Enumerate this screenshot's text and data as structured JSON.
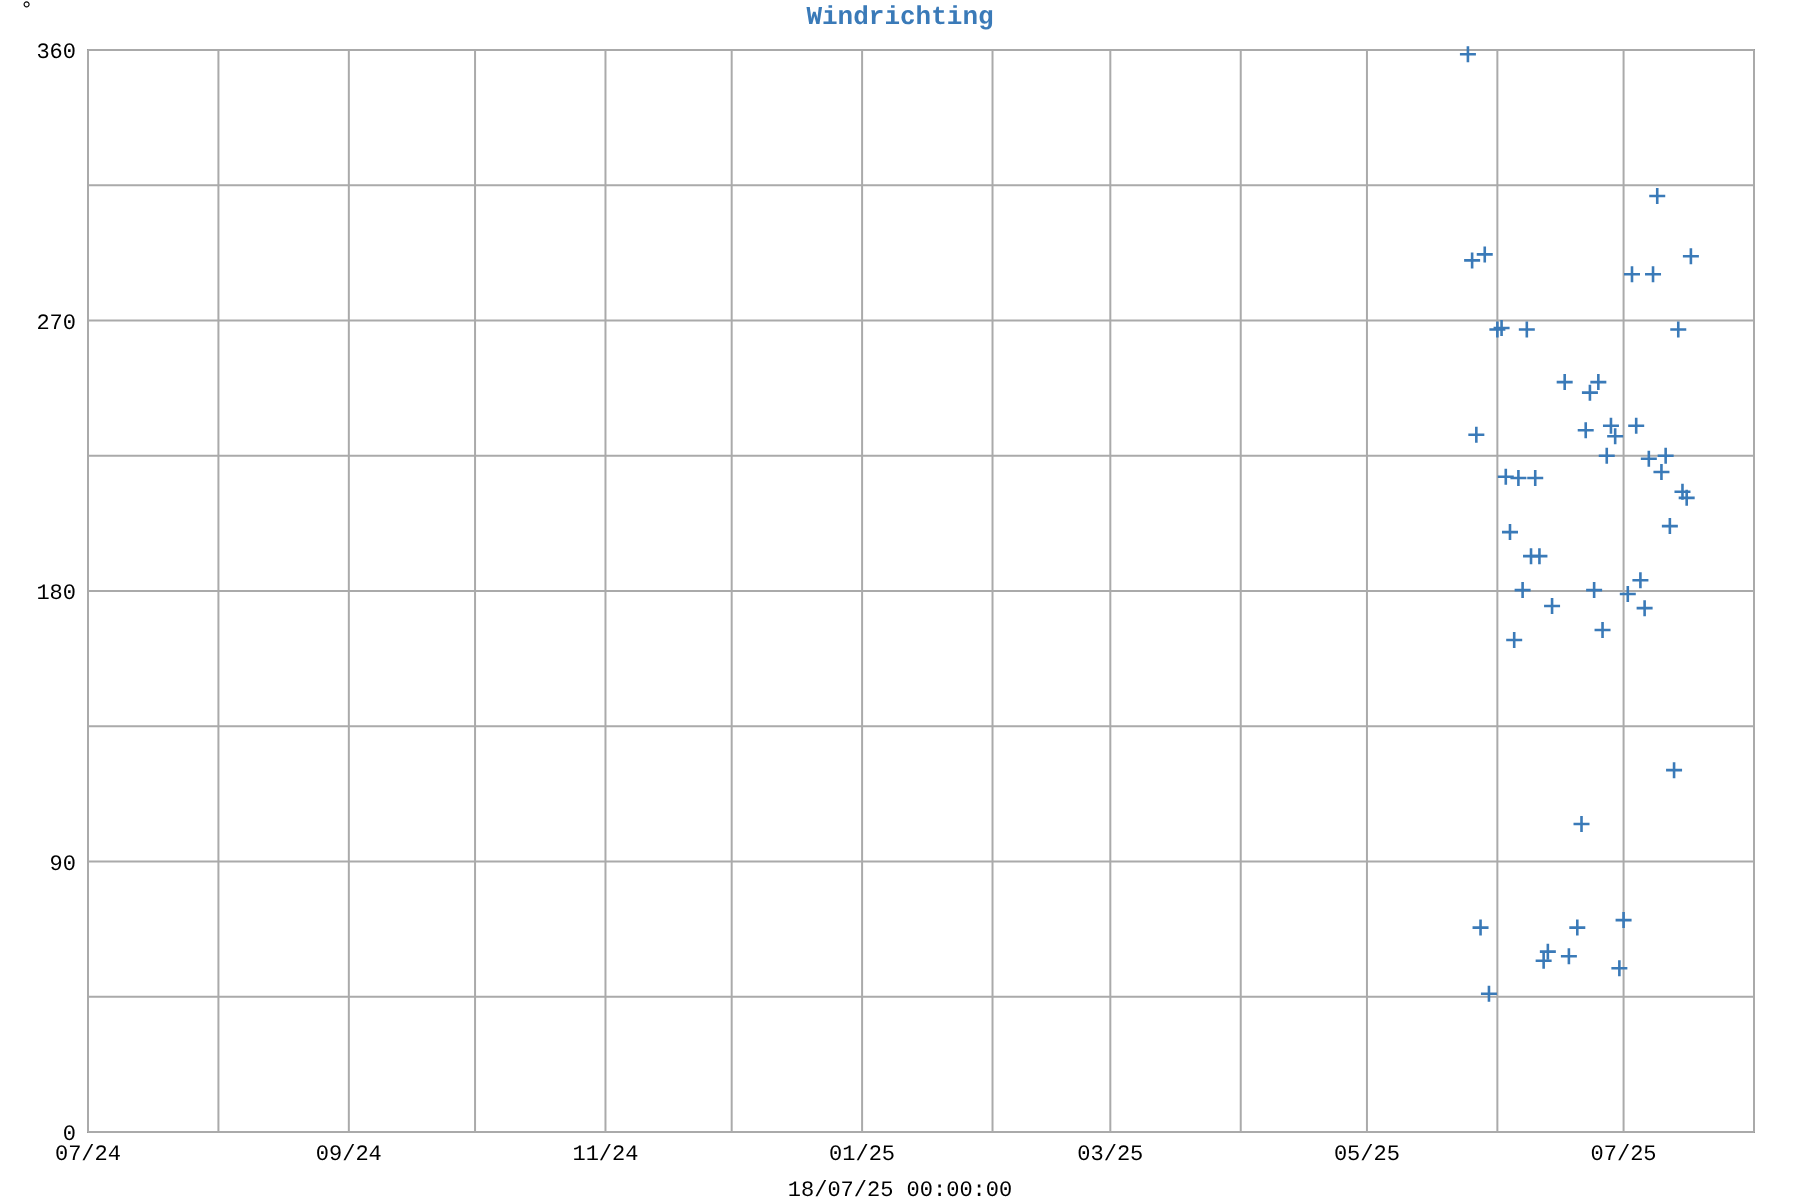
{
  "chart_data": {
    "type": "scatter",
    "title": "Windrichting",
    "ylabel": "°",
    "xlabel": "18/07/25 00:00:00",
    "xlim": [
      "2024-07-01",
      "2025-08-01"
    ],
    "ylim": [
      0,
      360
    ],
    "xticks": [
      {
        "value": "2024-07-01",
        "label": "07/24"
      },
      {
        "value": "2024-09-01",
        "label": "09/24"
      },
      {
        "value": "2024-11-01",
        "label": "11/24"
      },
      {
        "value": "2025-01-01",
        "label": "01/25"
      },
      {
        "value": "2025-03-01",
        "label": "03/25"
      },
      {
        "value": "2025-05-01",
        "label": "05/25"
      },
      {
        "value": "2025-07-01",
        "label": "07/25"
      }
    ],
    "yticks": [
      0,
      90,
      180,
      270,
      360
    ],
    "grid": true,
    "x": [
      "2025-05-25",
      "2025-05-26",
      "2025-05-29",
      "2025-05-27",
      "2025-05-28",
      "2025-05-30",
      "2025-06-03",
      "2025-06-06",
      "2025-06-10",
      "2025-06-04",
      "2025-06-08",
      "2025-06-01",
      "2025-06-02",
      "2025-06-05",
      "2025-06-07",
      "2025-06-09",
      "2025-06-11",
      "2025-06-14",
      "2025-06-12",
      "2025-06-13",
      "2025-06-17",
      "2025-06-18",
      "2025-06-20",
      "2025-06-21",
      "2025-06-22",
      "2025-06-23",
      "2025-06-25",
      "2025-06-24",
      "2025-06-26",
      "2025-06-27",
      "2025-06-28",
      "2025-06-29",
      "2025-06-30",
      "2025-07-01",
      "2025-07-02",
      "2025-07-03",
      "2025-07-04",
      "2025-07-05",
      "2025-07-06",
      "2025-07-07",
      "2025-07-08",
      "2025-07-09",
      "2025-07-10",
      "2025-07-11",
      "2025-07-12",
      "2025-07-13",
      "2025-07-14",
      "2025-07-15",
      "2025-07-16",
      "2025-07-17"
    ],
    "series": [
      {
        "color": "#3a7ab8",
        "values": [
          358.6,
          290,
          292,
          232,
          68,
          46,
          218,
          217.6,
          217.6,
          199.6,
          267,
          267,
          267.5,
          163.7,
          180.3,
          191.6,
          191.6,
          175,
          57,
          60,
          249.5,
          58.5,
          68,
          102.5,
          233.5,
          246,
          249.5,
          180.3,
          167,
          225,
          235,
          231.5,
          54.5,
          70.5,
          179,
          285.4,
          235,
          183.6,
          174.3,
          224,
          285.4,
          311.4,
          219.6,
          225,
          201.6,
          120.4,
          267,
          213,
          211,
          291.4
        ]
      }
    ]
  }
}
